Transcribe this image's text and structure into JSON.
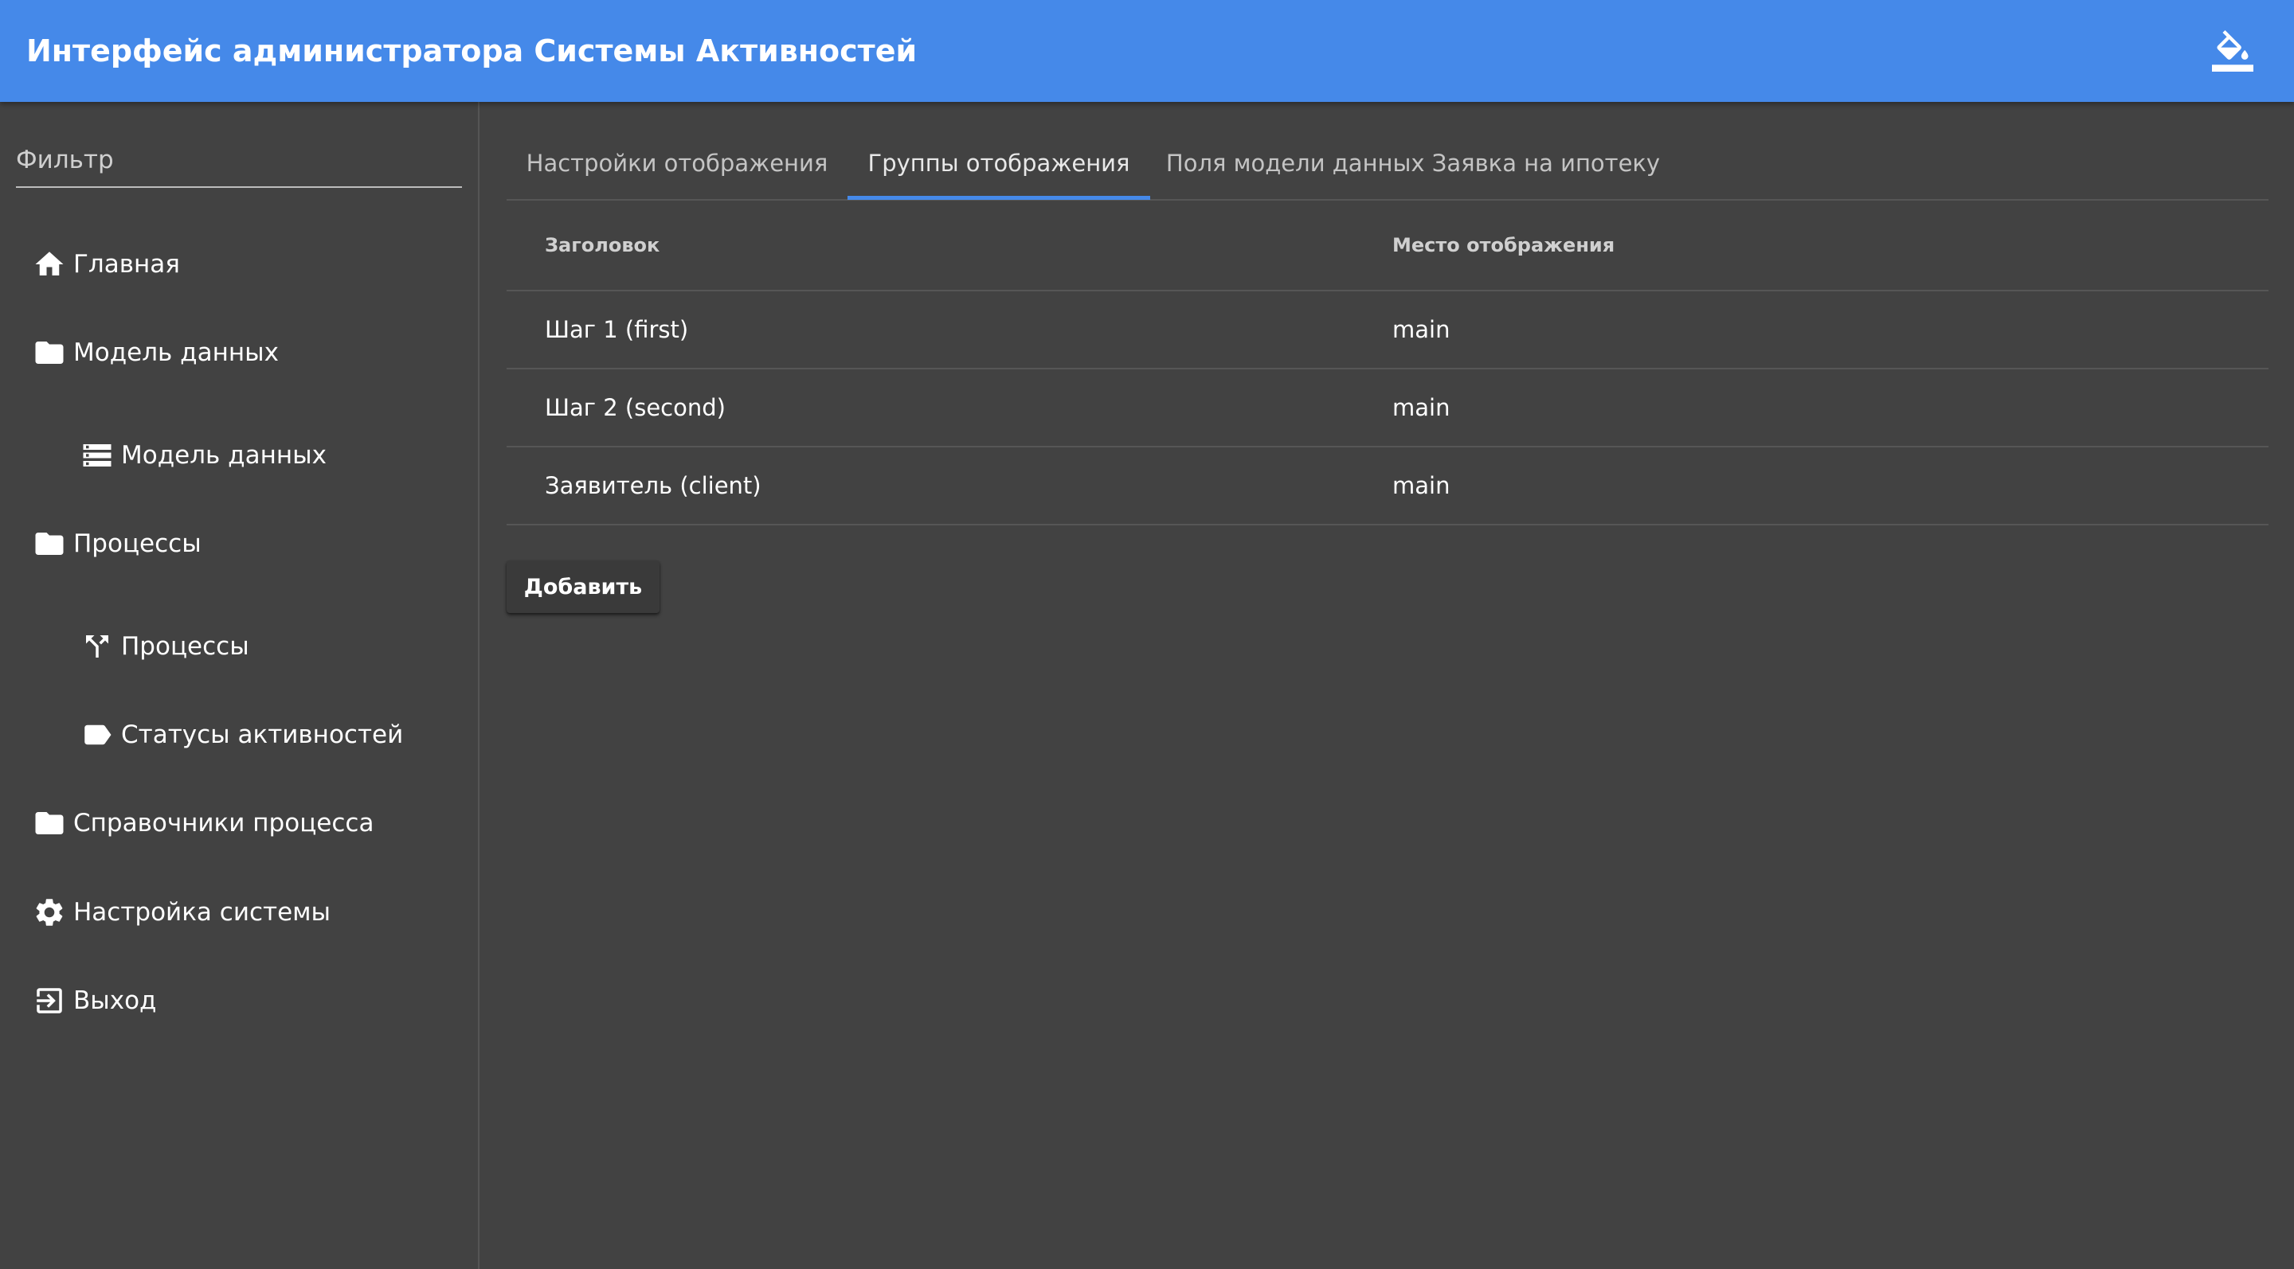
{
  "header": {
    "title": "Интерфейс администратора Системы Активностей",
    "theme_icon": "format-color-fill-icon"
  },
  "sidebar": {
    "filter_placeholder": "Фильтр",
    "filter_value": "",
    "items": [
      {
        "label": "Главная",
        "icon": "home-icon",
        "level": 0
      },
      {
        "label": "Модель данных",
        "icon": "folder-icon",
        "level": 0
      },
      {
        "label": "Модель данных",
        "icon": "storage-icon",
        "level": 1
      },
      {
        "label": "Процессы",
        "icon": "folder-icon",
        "level": 0
      },
      {
        "label": "Процессы",
        "icon": "merge-arrows-icon",
        "level": 1
      },
      {
        "label": "Статусы активностей",
        "icon": "label-tag-icon",
        "level": 1
      },
      {
        "label": "Справочники процесса",
        "icon": "folder-icon",
        "level": 0
      },
      {
        "label": "Настройка системы",
        "icon": "gear-icon",
        "level": 0
      },
      {
        "label": "Выход",
        "icon": "exit-icon",
        "level": 0
      }
    ]
  },
  "main": {
    "tabs": [
      {
        "label": "Настройки отображения",
        "active": false
      },
      {
        "label": "Группы отображения",
        "active": true
      },
      {
        "label": "Поля модели данных Заявка на ипотеку",
        "active": false
      }
    ],
    "table": {
      "columns": [
        "Заголовок",
        "Место отображения"
      ],
      "rows": [
        {
          "title": "Шаг 1 (first)",
          "place": "main"
        },
        {
          "title": "Шаг 2 (second)",
          "place": "main"
        },
        {
          "title": "Заявитель (client)",
          "place": "main"
        }
      ]
    },
    "add_button_label": "Добавить"
  },
  "colors": {
    "accent": "#4589e9",
    "background": "#424242",
    "divider": "#565656"
  }
}
